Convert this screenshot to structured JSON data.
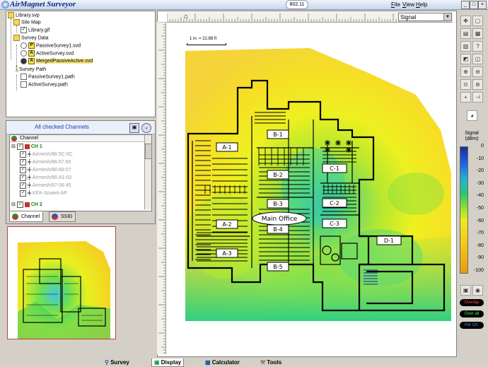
{
  "app": {
    "title": "AirMagnet Surveyor",
    "band": "802.11"
  },
  "menu": [
    "File",
    "View",
    "Help"
  ],
  "tree": {
    "items": [
      {
        "label": "Library.svp",
        "icon": "folder"
      },
      {
        "label": "Site Map",
        "icon": "folder"
      },
      {
        "label": "Library.gif",
        "icon": "checkbox-checked"
      },
      {
        "label": "Survey Data",
        "icon": "folder"
      },
      {
        "label": "PassiveSurvey1.svd",
        "icon": "passive-badge"
      },
      {
        "label": "ActiveSurvey.svd",
        "icon": "active-badge"
      },
      {
        "label": "MergedPassiveActive.svd",
        "icon": "active-badge"
      },
      {
        "label": "Survey Path",
        "icon": "walker"
      },
      {
        "label": "PassiveSurvey1.path",
        "icon": "checkbox"
      },
      {
        "label": "ActiveSurvey.path",
        "icon": "checkbox"
      }
    ]
  },
  "channels": {
    "header": "All checked Channels",
    "column": "Channel",
    "rows": [
      {
        "label": "CH 1",
        "style": "channel"
      },
      {
        "label": "Airmesh/86:5C:0C",
        "style": "ap"
      },
      {
        "label": "Airmesh/86:67:66",
        "style": "ap"
      },
      {
        "label": "Airmesh/86:68:07",
        "style": "ap"
      },
      {
        "label": "Airmesh/86:A1:03",
        "style": "ap"
      },
      {
        "label": "Airmesh/87:06:45",
        "style": "ap"
      },
      {
        "label": "KEK-Soweit-AP",
        "style": "ap"
      },
      {
        "label": "CH 2",
        "style": "channel"
      }
    ],
    "tabs": [
      "Channel",
      "SSID"
    ]
  },
  "display": {
    "mode": "Signal",
    "scale_label": "1 in. = 22.88 ft",
    "room_labels": [
      "B-1",
      "A-1",
      "C-1",
      "B-2",
      "B-3",
      "C-2",
      "Main Office",
      "A-2",
      "B-4",
      "C-3",
      "D-1",
      "A-3",
      "B-5"
    ]
  },
  "legend": {
    "title": "Signal (dBm)",
    "ticks": [
      "0",
      "-10",
      "-20",
      "-30",
      "-40",
      "-50",
      "-60",
      "-70",
      "-80",
      "-90",
      "-100"
    ],
    "buttons": [
      "Overlap",
      "Over all",
      "Per Ch."
    ],
    "button_colors": [
      "#ff5050",
      "#30ff30",
      "#5090ff"
    ]
  },
  "bottom_tabs": [
    "Survey",
    "Display",
    "Calculator",
    "Tools"
  ],
  "colors": {
    "title_text": "#0c2a7a",
    "accent": "#1a3fa0"
  }
}
